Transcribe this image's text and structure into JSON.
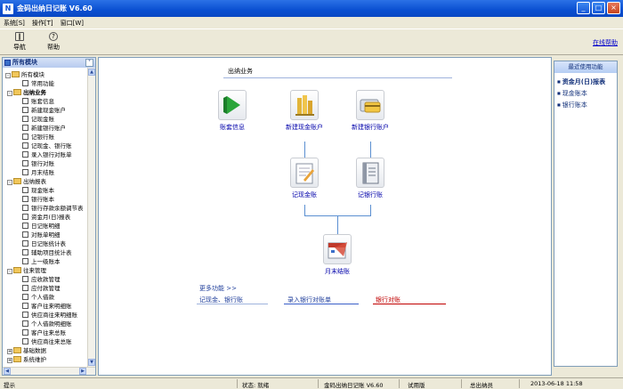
{
  "window": {
    "title": "金码出纳日记账  V6.60"
  },
  "menu": [
    "系统[S]",
    "操作[T]",
    "窗口[W]"
  ],
  "toolbar": {
    "nav": "导航",
    "help": "帮助",
    "online_help": "在线帮助"
  },
  "sidebar": {
    "title": "所有模块",
    "tree": [
      {
        "label": "所有模块",
        "type": "root"
      },
      {
        "label": "常用功能",
        "type": "leaf"
      },
      {
        "label": "出纳业务",
        "type": "folder"
      },
      {
        "label": "账套信息",
        "type": "leaf"
      },
      {
        "label": "新建现金账户",
        "type": "leaf"
      },
      {
        "label": "记现金账",
        "type": "leaf"
      },
      {
        "label": "新建银行账户",
        "type": "leaf"
      },
      {
        "label": "记银行账",
        "type": "leaf"
      },
      {
        "label": "记现金、银行账",
        "type": "leaf"
      },
      {
        "label": "录入银行对账单",
        "type": "leaf"
      },
      {
        "label": "银行对账",
        "type": "leaf"
      },
      {
        "label": "月末结账",
        "type": "leaf"
      },
      {
        "label": "出纳报表",
        "type": "folder"
      },
      {
        "label": "现金账本",
        "type": "leaf"
      },
      {
        "label": "银行账本",
        "type": "leaf"
      },
      {
        "label": "银行存款余额调节表",
        "type": "leaf"
      },
      {
        "label": "资金月(日)报表",
        "type": "leaf"
      },
      {
        "label": "日记账明细",
        "type": "leaf"
      },
      {
        "label": "对账单明细",
        "type": "leaf"
      },
      {
        "label": "日记账统计表",
        "type": "leaf"
      },
      {
        "label": "辅助项目统计表",
        "type": "leaf"
      },
      {
        "label": "上一级账本",
        "type": "leaf"
      },
      {
        "label": "往来管理",
        "type": "folder"
      },
      {
        "label": "应收款管理",
        "type": "leaf"
      },
      {
        "label": "应付款管理",
        "type": "leaf"
      },
      {
        "label": "个人借款",
        "type": "leaf"
      },
      {
        "label": "客户往来明细账",
        "type": "leaf"
      },
      {
        "label": "供应商往来明细账",
        "type": "leaf"
      },
      {
        "label": "个人借款明细账",
        "type": "leaf"
      },
      {
        "label": "客户往来总账",
        "type": "leaf"
      },
      {
        "label": "供应商往来总账",
        "type": "leaf"
      },
      {
        "label": "基础数据",
        "type": "folder"
      },
      {
        "label": "系统维护",
        "type": "folder"
      }
    ]
  },
  "main": {
    "section_title": "出纳业务",
    "functions": {
      "account_info": "账套信息",
      "new_cash": "新建现金账户",
      "new_bank": "新建银行账户",
      "cash_book": "记现金账",
      "bank_book": "记银行账",
      "month_close": "月末结账"
    },
    "more": {
      "title": "更多功能 >>",
      "links": [
        "记现金、银行账",
        "录入银行对账单",
        "银行对账"
      ]
    }
  },
  "right_panel": {
    "title": "最近使用功能",
    "items": [
      "资金月(日)报表",
      "现金账本",
      "银行账本"
    ]
  },
  "status": {
    "hint": "提示",
    "state": "状态: 就绪",
    "product": "金码出纳日记账   V6.60",
    "edition": "试用版",
    "company": "总出纳员",
    "datetime": "2013-06-18 11:58"
  },
  "colors": {
    "accent": "#0a4fd1",
    "link": "#1f3e9b",
    "link_red": "#c00000"
  }
}
